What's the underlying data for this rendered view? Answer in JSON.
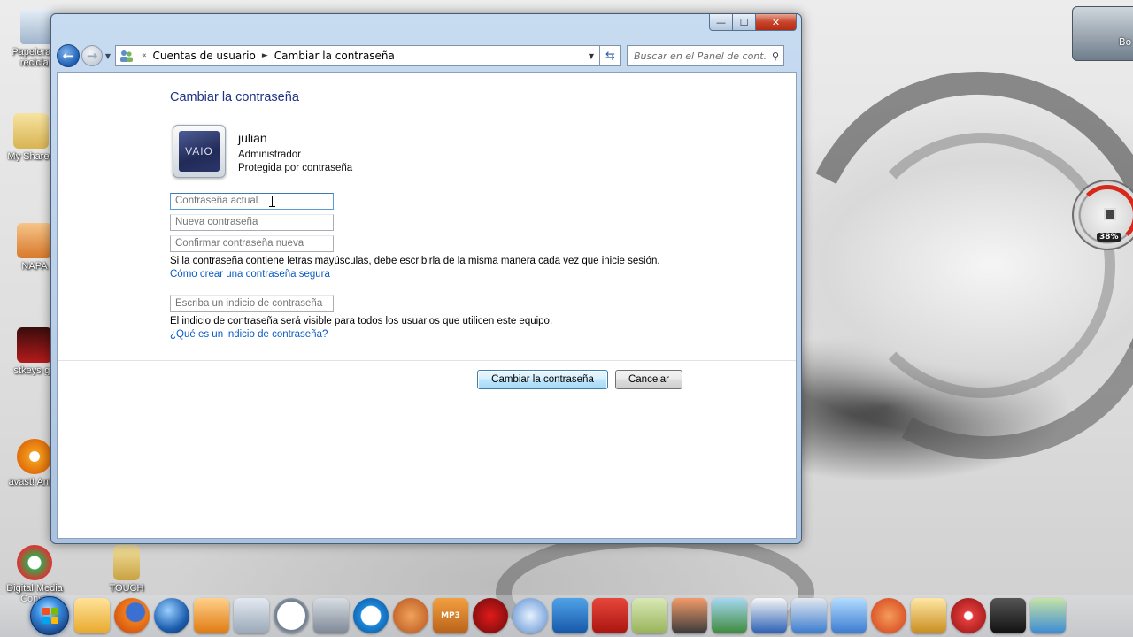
{
  "window": {
    "caption": {
      "minimize": "—",
      "maximize": "☐",
      "close": "✕"
    },
    "breadcrumb": {
      "sep_start": "«",
      "root": "Cuentas de usuario",
      "sep": "►",
      "current": "Cambiar la contraseña"
    },
    "search_placeholder": "Buscar en el Panel de cont..."
  },
  "page": {
    "title": "Cambiar la contraseña",
    "user": {
      "name": "julian",
      "role": "Administrador",
      "status": "Protegida por contraseña",
      "avatar_label": "VAIO"
    },
    "fields": {
      "current_password": "Contraseña actual",
      "new_password": "Nueva contraseña",
      "confirm_password": "Confirmar contraseña nueva",
      "hint": "Escriba un indicio de contraseña"
    },
    "note_case": "Si la contraseña contiene letras mayúsculas, debe escribirla de la misma manera cada vez que inicie sesión.",
    "link_secure": "Cómo crear una contraseña segura",
    "note_hint": "El indicio de contraseña será visible para todos los usuarios que utilicen este equipo.",
    "link_hint": "¿Qué es un indicio de contraseña?",
    "buttons": {
      "change": "Cambiar la contraseña",
      "cancel": "Cancelar"
    }
  },
  "desktop": {
    "icons": [
      {
        "label": "Papelera de reciclaje",
        "name": "recycle-bin-icon"
      },
      {
        "label": "My Shared",
        "name": "shared-folder-icon"
      },
      {
        "label": "NAPA",
        "name": "napa-shortcut-icon"
      },
      {
        "label": "stkeys-gu",
        "name": "stkeys-icon"
      },
      {
        "label": "avast! Antivi",
        "name": "avast-icon"
      },
      {
        "label": "Digital Media Conve",
        "name": "digital-media-icon"
      },
      {
        "label": "TOUCH",
        "name": "touch-folder-icon"
      }
    ],
    "gadget_text": "Bo",
    "gauge_percent": "38%"
  },
  "taskbar": {
    "dock_labels": {
      "mp3": "MP3"
    }
  },
  "colors": {
    "accent": "#1e3287",
    "link": "#0b5cc4",
    "primary_button": "#a7d9f5"
  }
}
